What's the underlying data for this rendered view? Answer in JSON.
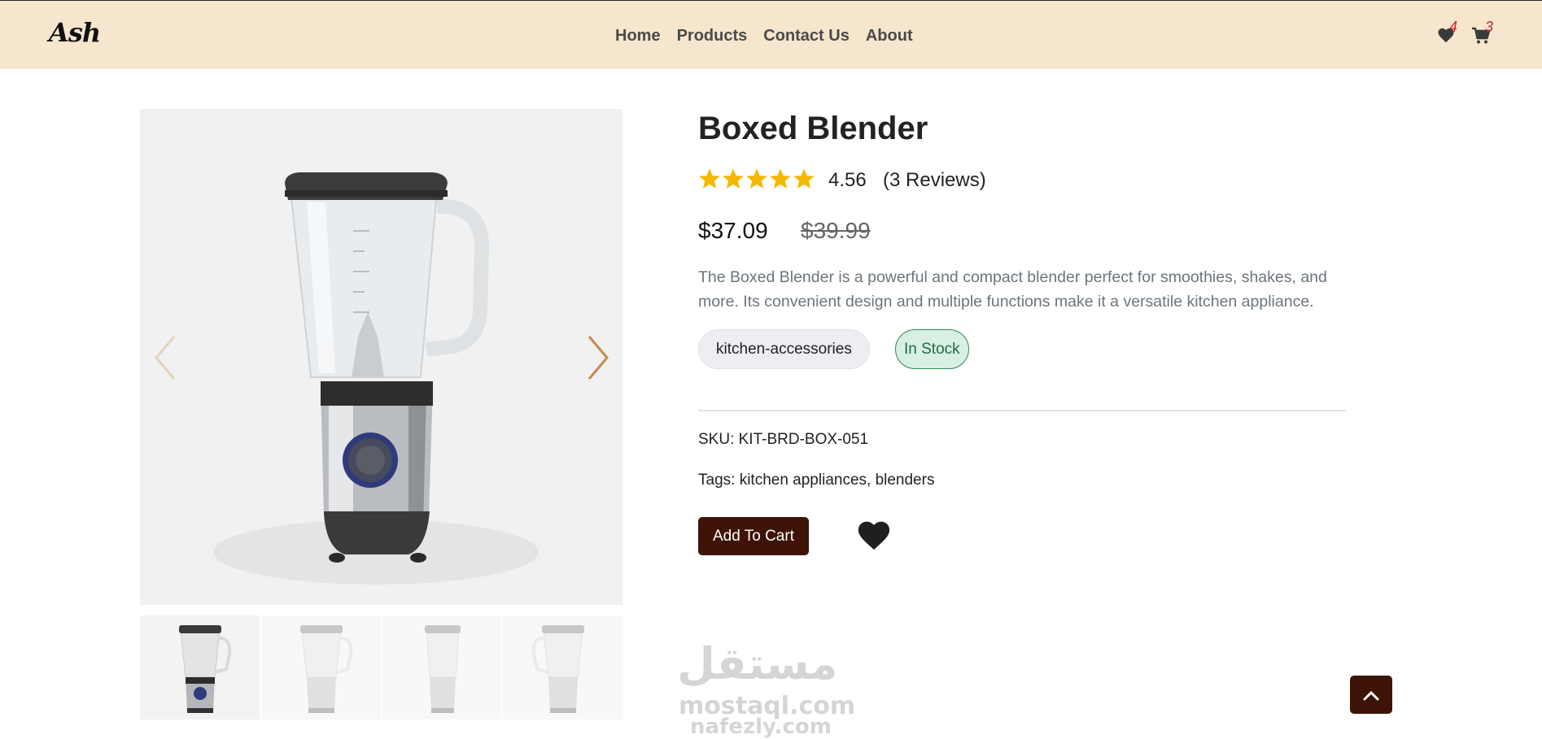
{
  "navbar": {
    "brand": "Ash",
    "links": [
      "Home",
      "Products",
      "Contact Us",
      "About"
    ],
    "wishlist_count": "4",
    "cart_count": "3",
    "background": "#f5e6cd"
  },
  "gallery": {
    "main_image_alt": "blender-product-image",
    "prev_icon": "chevron-left-icon",
    "next_icon": "chevron-right-icon",
    "thumbnail_count": 4,
    "active_thumbnail": 1
  },
  "product": {
    "title": "Boxed Blender",
    "rating": "4.56",
    "rating_value": 4.56,
    "stars_max": 5,
    "reviews": "(3 Reviews)",
    "price": "$37.09",
    "old_price": "$39.99",
    "description": "The Boxed Blender is a powerful and compact blender perfect for smoothies, shakes, and more. Its convenient design and multiple functions make it a versatile kitchen appliance.",
    "category": "kitchen-accessories",
    "stock_status": "In Stock",
    "sku_label": "SKU: KIT-BRD-BOX-051",
    "tags_label": "Tags: kitchen appliances, blenders",
    "add_to_cart": "Add To Cart"
  },
  "watermark": {
    "arabic": "مستقل",
    "line1": "mostaql.com",
    "line2": "nafezly.com"
  },
  "colors": {
    "accent_dark": "#3d1405",
    "star": "#f5b800",
    "badge": "#d32030",
    "stock_green": "#1e6b44"
  },
  "icons": {
    "wishlist": "heart-icon",
    "cart": "cart-icon",
    "scroll_top": "chevron-up-icon"
  }
}
